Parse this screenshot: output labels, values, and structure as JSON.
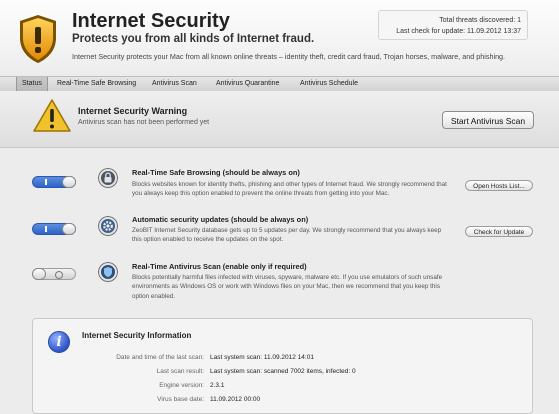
{
  "header": {
    "title": "Internet Security",
    "subtitle": "Protects you from all kinds of Internet fraud.",
    "description": "Internet Security protects your Mac from all known online threats – identity theft, credit card fraud, Trojan horses, malware, and phishing.",
    "threats_label": "Total threats discovered: 1",
    "last_check_label": "Last check for update: 11.09.2012 13:37"
  },
  "tabs": [
    {
      "label": "Status",
      "active": true
    },
    {
      "label": "Real-Time Safe Browsing",
      "active": false
    },
    {
      "label": "Antivirus Scan",
      "active": false
    },
    {
      "label": "Antivirus Quarantine",
      "active": false
    },
    {
      "label": "Antivirus Schedule",
      "active": false
    }
  ],
  "warning": {
    "title": "Internet Security Warning",
    "subtitle": "Antivirus scan has not been performed yet",
    "button": "Start Antivirus Scan"
  },
  "features": [
    {
      "toggle": "on",
      "icon": "lock-icon",
      "title": "Real-Time Safe Browsing (should be always on)",
      "description": "Blocks websites known for identity thefts, phishing and other types of Internet fraud. We strongly recommend that you always keep this option enabled to prevent the online threats from getting into your Mac.",
      "button": "Open Hosts List..."
    },
    {
      "toggle": "on",
      "icon": "update-gear-icon",
      "title": "Automatic security updates (should be always on)",
      "description": "ZeoBIT Internet Security database gets up to 5 updates per day. We strongly recommend that you always keep this option enabled to receive the updates on the spot.",
      "button": "Check for Update"
    },
    {
      "toggle": "off",
      "icon": "antivirus-shield-icon",
      "title": "Real-Time Antivirus Scan (enable only if required)",
      "description": "Blocks potentially harmful files infected with viruses, spyware, malware etc. If you use emulators of such unsafe environments as Windows OS or work with Windows files on your Mac, then we recommend that you keep this option enabled.",
      "button": ""
    }
  ],
  "info": {
    "title": "Internet Security Information",
    "rows": [
      {
        "label": "Date and time of the last scan:",
        "value": "Last system scan: 11.09.2012 14:01"
      },
      {
        "label": "Last scan result:",
        "value": "Last system scan: scanned 7002 items, infected: 0"
      },
      {
        "label": "Engine version:",
        "value": "2.3.1"
      },
      {
        "label": "Virus base date:",
        "value": "11.09.2012 00:00"
      }
    ],
    "icon_glyph": "i"
  },
  "colors": {
    "toggle_on": "#2f63c4",
    "warning_yellow": "#f2c12e",
    "shield_orange": "#f0a818"
  }
}
